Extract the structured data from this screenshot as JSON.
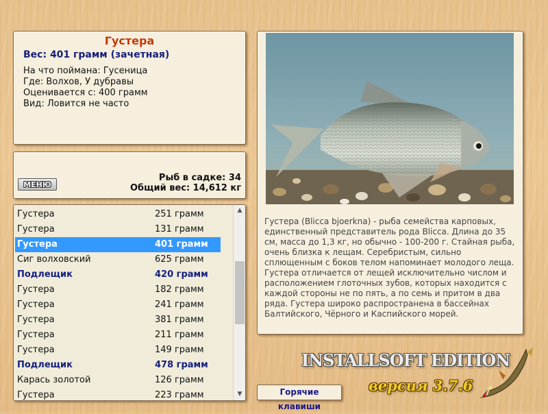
{
  "info": {
    "fish_name": "Густера",
    "weight_line": "Вес: 401 грамм (зачетная)",
    "caught_on": "На что поймана: Гусеница",
    "location": "Где: Волхов, У дубравы",
    "valued_from": "Оценивается с: 400 грамм",
    "frequency": "Вид: Ловится не часто"
  },
  "summary": {
    "menu_label": "МЕНЮ",
    "catch_count": "Рыб в садке: 34",
    "total_weight": "Общий вес: 14,612 кг"
  },
  "catch_list": [
    {
      "name": "Густера",
      "weight": "251 грамм"
    },
    {
      "name": "Густера",
      "weight": "131 грамм"
    },
    {
      "name": "Густера",
      "weight": "401 грамм"
    },
    {
      "name": "Сиг волховский",
      "weight": "625 грамм"
    },
    {
      "name": "Подлещик",
      "weight": "420 грамм"
    },
    {
      "name": "Густера",
      "weight": "182 грамм"
    },
    {
      "name": "Густера",
      "weight": "241 грамм"
    },
    {
      "name": "Густера",
      "weight": "381 грамм"
    },
    {
      "name": "Густера",
      "weight": "211 грамм"
    },
    {
      "name": "Густера",
      "weight": "149 грамм"
    },
    {
      "name": "Подлещик",
      "weight": "478 грамм"
    },
    {
      "name": "Карась золотой",
      "weight": "126 грамм"
    },
    {
      "name": "Густера",
      "weight": "223 грамм"
    }
  ],
  "selected_index": 2,
  "bold_indices": [
    4,
    10
  ],
  "description": "Густера (Blicca bjoerkna) - рыба семейства карповых, единственный представитель рода Blicca. Длина до 35 см, масса до 1,3 кг, но обычно - 100-200 г. Стайная рыба, очень близка к лещам. Серебристым, сильно сплющенным с боков телом напоминает молодого леща. Густера отличается от лещей исключительно числом и расположением глоточных зубов, которых находится с каждой стороны не по пять, а по семь и притом в два ряда. Густера широко распространена в бассейнах Балтийского, Чёрного и Каспийского морей.",
  "hotkeys_label": "Горячие клавиши",
  "brand": "INSTALLSOFT EDITION",
  "version": "версия 3.7.6",
  "colors": {
    "fish_name": "#c23a0a",
    "accent_blue": "#16207a",
    "selection": "#3399ff",
    "version_gold": "#f2cc2a"
  },
  "icons": [
    "scroll-up-icon",
    "scroll-down-icon",
    "pike-logo-icon"
  ]
}
